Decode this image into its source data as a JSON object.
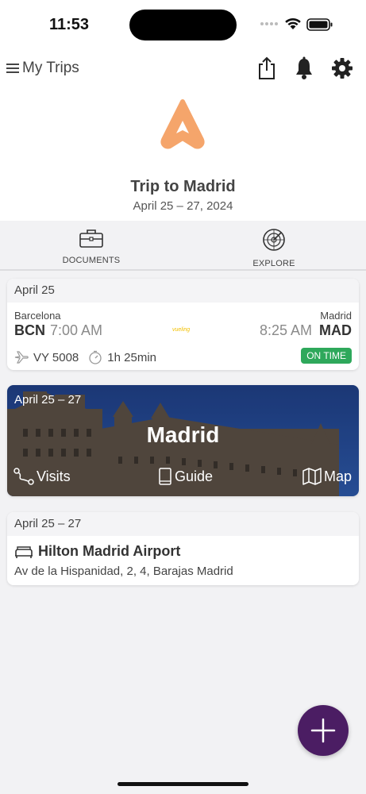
{
  "status_bar": {
    "time": "11:53"
  },
  "header": {
    "title": "My Trips"
  },
  "trip": {
    "title": "Trip to Madrid",
    "dates": "April 25 – 27, 2024"
  },
  "tabs": [
    {
      "label": "DOCUMENTS",
      "icon": "briefcase-icon"
    },
    {
      "label": "EXPLORE",
      "icon": "radar-icon"
    }
  ],
  "flight": {
    "date": "April 25",
    "departure_city": "Barcelona",
    "departure_code": "BCN",
    "departure_time": "7:00 AM",
    "arrival_city": "Madrid",
    "arrival_time": "8:25 AM",
    "arrival_code": "MAD",
    "airline": "vueling",
    "flight_number": "VY 5008",
    "duration": "1h 25min",
    "status": "ON TIME"
  },
  "destination": {
    "dates": "April 25 – 27",
    "city": "Madrid",
    "visits_label": "Visits",
    "guide_label": "Guide",
    "map_label": "Map"
  },
  "hotel": {
    "dates": "April 25 – 27",
    "name": "Hilton Madrid Airport",
    "address": "Av de la Hispanidad, 2, 4, Barajas Madrid"
  },
  "colors": {
    "accent": "#4b1d63",
    "logo": "#f5a56b",
    "status_ok": "#2ea85b"
  }
}
